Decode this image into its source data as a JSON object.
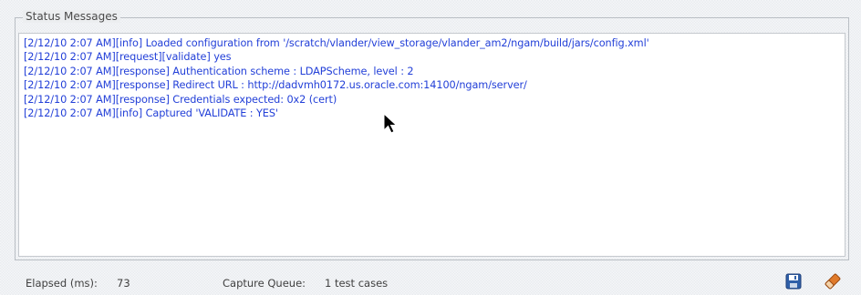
{
  "panel": {
    "title": "Status Messages",
    "log_lines": [
      "[2/12/10 2:07 AM][info] Loaded configuration from '/scratch/vlander/view_storage/vlander_am2/ngam/build/jars/config.xml'",
      "[2/12/10 2:07 AM][request][validate] yes",
      "[2/12/10 2:07 AM][response] Authentication scheme : LDAPScheme, level : 2",
      "[2/12/10 2:07 AM][response] Redirect URL : http://dadvmh0172.us.oracle.com:14100/ngam/server/",
      "[2/12/10 2:07 AM][response] Credentials expected: 0x2 (cert)",
      "[2/12/10 2:07 AM][info] Captured 'VALIDATE : YES'"
    ]
  },
  "statusbar": {
    "elapsed_label": "Elapsed (ms):",
    "elapsed_value": "73",
    "queue_label": "Capture Queue:",
    "queue_value": "1 test cases"
  },
  "icons": {
    "save": "save-icon",
    "clear": "eraser-icon",
    "cursor": "mouse-pointer-icon"
  },
  "colors": {
    "log_text": "#2340d8",
    "save_icon": "#2f5fa8",
    "eraser_icon": "#e07a2a"
  }
}
